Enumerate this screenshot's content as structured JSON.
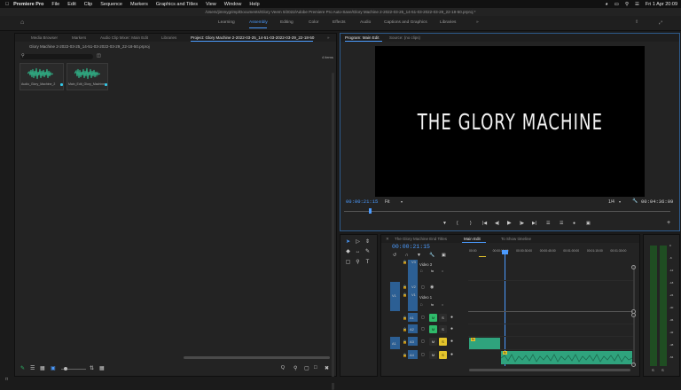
{
  "macbar": {
    "app": "Premiere Pro",
    "menus": [
      "File",
      "Edit",
      "Clip",
      "Sequence",
      "Markers",
      "Graphics and Titles",
      "View",
      "Window",
      "Help"
    ],
    "clock": "Fri 1 Apr 20:09"
  },
  "window_title": "/Users/jimmygrimp/Documents/Glory Veem 0/2022/Adobe Premiere Pro Auto-Save/Glory Machine 2-2022-03-25_14-51-03-2022-03-29_22-18-50.prproj *",
  "workspace": {
    "tabs": [
      "Learning",
      "Assembly",
      "Editing",
      "Color",
      "Effects",
      "Audio",
      "Captions and Graphics",
      "Libraries"
    ],
    "active": "Assembly"
  },
  "project_panel": {
    "tabs": [
      "Media Browser",
      "Markers",
      "Audio Clip Mixer: Main Edit",
      "Libraries",
      "Project: Glory Machine 2-2022-03-25_14-51-03-2022-03-29_22-18-50"
    ],
    "active_tab": "Project: Glory Machine 2-2022-03-25_14-51-03-2022-03-29_22-18-50",
    "file_path": "Glory Machine 2-2022-03-25_14-51-03-2022-03-29_22-18-50.prproj",
    "item_count": "4 items",
    "clips": [
      {
        "name": "Audio_Glory_Machine_2"
      },
      {
        "name": "Main_Edit_Glory_Machine"
      }
    ]
  },
  "program_monitor": {
    "tabs": [
      "Program: Main Edit",
      "Source: (no clips)"
    ],
    "active_tab": "Program: Main Edit",
    "title_text": "THE GLORY MACHINE",
    "current_timecode": "00:00:21:15",
    "duration_timecode": "00:04:36:09",
    "fit": "Fit",
    "resolution": "1/4",
    "playhead_fraction": 0.08
  },
  "timeline": {
    "tabs": [
      "The Glory Machine End Titles",
      "Main Edit",
      "To Show timeline"
    ],
    "active_tab": "Main Edit",
    "timecode": "00:00:21:15",
    "ruler": [
      "00:00",
      "00:00:15:00",
      "00:00:30:00",
      "00:00:45:00",
      "00:01:00:00",
      "00:01:15:00",
      "00:01:30:00"
    ],
    "tracks": [
      {
        "name": "V3",
        "label": "Video 3"
      },
      {
        "name": "V2",
        "label": ""
      },
      {
        "name": "V1",
        "label": "Video 1"
      },
      {
        "name": "A1",
        "label": ""
      },
      {
        "name": "A2",
        "label": ""
      },
      {
        "name": "A3",
        "label": ""
      },
      {
        "name": "A4",
        "label": ""
      }
    ],
    "source_labels": [
      "V1",
      "A1"
    ],
    "audio_clip_label": "fx"
  },
  "audio_meter": {
    "scale": [
      "0",
      "-6",
      "-12",
      "-18",
      "-24",
      "-30",
      "-36",
      "-42",
      "-48",
      "-54"
    ],
    "channels": [
      "S",
      "S"
    ]
  },
  "colors": {
    "accent": "#4b9bff",
    "clip_green": "#2fa37d",
    "track_blue": "#2c5f94",
    "solo_yellow": "#e3c42c",
    "mute_green": "#2fba6a"
  }
}
